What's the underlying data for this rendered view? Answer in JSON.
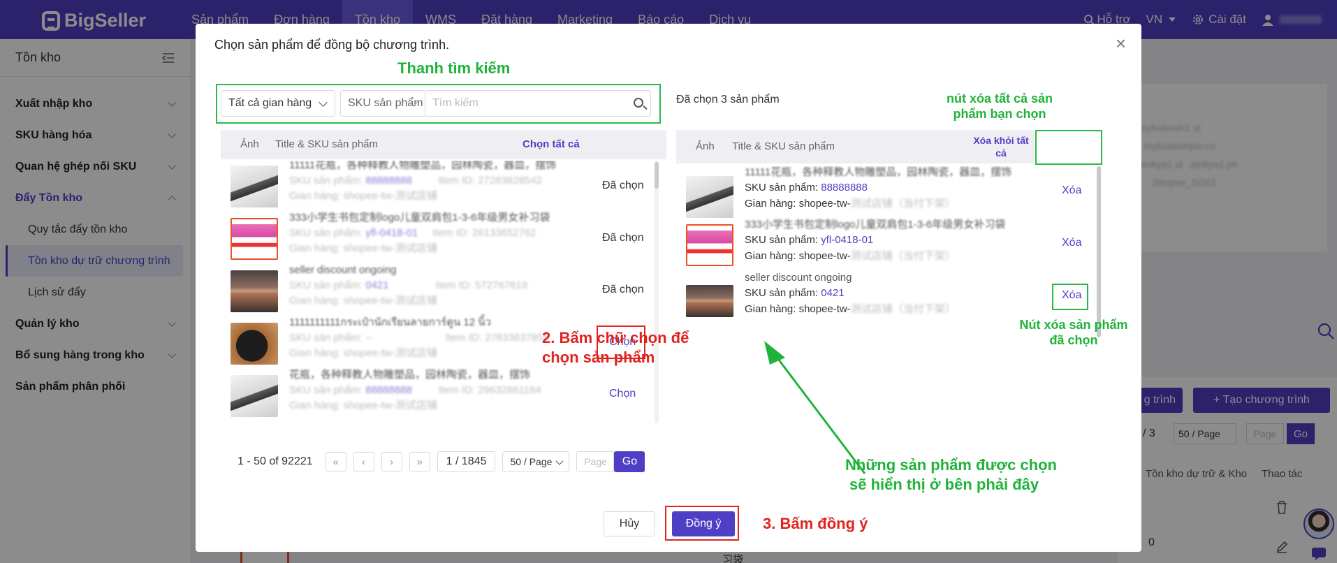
{
  "app": {
    "logo": "BigSeller"
  },
  "nav": {
    "items": [
      "Sản phẩm",
      "Đơn hàng",
      "Tồn kho",
      "WMS",
      "Đặt hàng",
      "Marketing",
      "Báo cáo",
      "Dịch vụ"
    ],
    "active_index": 2,
    "help": "Hỗ trợ",
    "lang": "VN",
    "settings": "Cài đặt"
  },
  "sidebar": {
    "title": "Tồn kho",
    "items": [
      {
        "label": "Xuất nhập kho"
      },
      {
        "label": "SKU hàng hóa"
      },
      {
        "label": "Quan hệ ghép nối SKU"
      },
      {
        "label": "Đẩy Tồn kho"
      },
      {
        "label": "Quy tắc đẩy tồn kho"
      },
      {
        "label": "Tồn kho dự trữ chương trình"
      },
      {
        "label": "Lịch sử đẩy"
      },
      {
        "label": "Quản lý kho"
      },
      {
        "label": "Bổ sung hàng trong kho"
      },
      {
        "label": "Sản phẩm phân phối"
      }
    ]
  },
  "background": {
    "btn_create_partial": "g trình",
    "btn_create": "+ Tạo chương trình",
    "pager_total": "/ 3",
    "pager_size": "50 / Page",
    "pager_page_placeholder": "Page",
    "pager_go": "Go",
    "col_stock": "Tồn kho dự trữ & Kho",
    "col_action": "Thao tác",
    "qty": "0",
    "bag_label": "习袋"
  },
  "modal": {
    "title": "Chọn sản phẩm để đồng bộ chương trình.",
    "search": {
      "store_select": "Tất cả gian hàng",
      "field_select": "SKU sản phẩm",
      "placeholder": "Tìm kiếm"
    },
    "left": {
      "col_image": "Ảnh",
      "col_title": "Title & SKU sản phẩm",
      "select_all": "Chọn tất cả",
      "sku_label": "SKU sản phẩm:",
      "store_label": "Gian hàng:",
      "rows": [
        {
          "title": "11111花瓶，各种释教人物雕塑品，园林陶瓷，器皿，摆饰",
          "sku": "88888888",
          "item_id": "Item ID: 27283828542",
          "store": "shopee-tw-测试店铺",
          "status": "Đã chọn"
        },
        {
          "title": "333小学生书包定制logo儿童双肩包1-3-6年级男女补习袋",
          "sku": "yfl-0418-01",
          "item_id": "Item ID: 26133652762",
          "store": "shopee-tw-测试店铺",
          "status": "Đã chọn"
        },
        {
          "title": "seller discount ongoing",
          "sku": "0421",
          "item_id": "Item ID: 572767619",
          "store": "shopee-tw-测试店铺",
          "status": "Đã chọn"
        },
        {
          "title": "1111111111กระเป๋านักเรียนลายการ์ตูน 12 นิ้ว",
          "sku": "--",
          "item_id": "Item ID: 27833637855",
          "store": "shopee-tw-测试店铺",
          "status": "Chọn"
        },
        {
          "title": "花瓶，各种释教人物雕塑品，园林陶瓷，器皿，摆饰",
          "sku": "88888888",
          "item_id": "Item ID: 29632861164",
          "store": "shopee-tw-测试店铺",
          "status": "Chọn"
        }
      ],
      "pager": {
        "range": "1 - 50 of 92221",
        "page": "1 / 1845",
        "size": "50 / Page",
        "page_placeholder": "Page",
        "go": "Go"
      }
    },
    "right": {
      "selected_count": "Đã chọn 3 sản phẩm",
      "col_image": "Ảnh",
      "col_title": "Title & SKU sản phẩm",
      "remove_all": "Xóa khỏi tất cả",
      "sku_label": "SKU sản phẩm:",
      "store_label": "Gian hàng:",
      "rows": [
        {
          "title": "11111花瓶，各种释教人物雕塑品，园林陶瓷，器皿，摆饰",
          "sku": "88888888",
          "store_prefix": "shopee-tw-",
          "action": "Xóa"
        },
        {
          "title": "333小学生书包定制logo儿童双肩包1-3-6年级男女补习袋",
          "sku": "yfl-0418-01",
          "store_prefix": "shopee-tw-",
          "action": "Xóa"
        },
        {
          "title": "seller discount ongoing",
          "sku": "0421",
          "store_prefix": "shopee-tw-",
          "action": "Xóa"
        }
      ]
    },
    "cancel": "Hủy",
    "ok": "Đồng ý"
  },
  "annotations": {
    "search_bar": "Thanh tìm kiếm",
    "remove_all_line1": "nút xóa tất cả sản",
    "remove_all_line2": "phẩm bạn chọn",
    "remove_one_line1": "Nút xóa sản phẩm",
    "remove_one_line2": "đã chọn",
    "step2_line1": "2. Bấm chữ chọn để",
    "step2_line2": "chọn sản phẩm",
    "selected_line1": "Những sản phẩm được chọn",
    "selected_line2": "sẽ hiển thị ở bên phải đây",
    "step3": "3. Bấm đồng ý"
  },
  "colors": {
    "brand": "#4f3fc4",
    "annotation_green": "#20b33a",
    "annotation_red": "#e0231e"
  }
}
